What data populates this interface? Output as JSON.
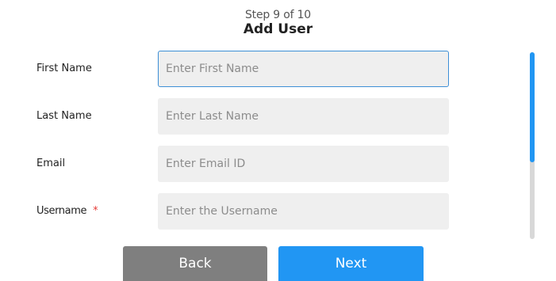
{
  "header": {
    "step_text": "Step 9 of 10",
    "title": "Add User"
  },
  "form": {
    "fields": [
      {
        "label": "First Name",
        "placeholder": "Enter First Name",
        "value": "",
        "required": false,
        "focused": true
      },
      {
        "label": "Last Name",
        "placeholder": "Enter Last Name",
        "value": "",
        "required": false,
        "focused": false
      },
      {
        "label": "Email",
        "placeholder": "Enter Email ID",
        "value": "",
        "required": false,
        "focused": false
      },
      {
        "label": "Username",
        "placeholder": "Enter the Username",
        "value": "",
        "required": true,
        "required_marker": "*",
        "focused": false
      }
    ]
  },
  "scrollbar": {
    "position_fraction": 0.0,
    "visible_fraction": 0.59
  },
  "buttons": {
    "back_label": "Back",
    "next_label": "Next"
  },
  "colors": {
    "accent": "#2196f3",
    "focus_border": "#3d8fd6",
    "secondary_button": "#7f7f7f",
    "input_background": "#efefef",
    "required": "#e53935"
  }
}
